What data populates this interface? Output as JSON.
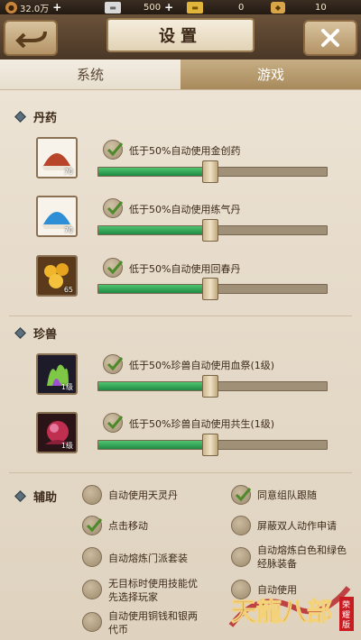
{
  "currency": {
    "copper": {
      "value": "32.0万"
    },
    "silver": {
      "value": "500"
    },
    "gold": {
      "value": "0"
    },
    "jade": {
      "value": "10"
    }
  },
  "header": {
    "title": "设置"
  },
  "tabs": [
    {
      "label": "系统",
      "active": false
    },
    {
      "label": "游戏",
      "active": true
    }
  ],
  "medicine": {
    "title": "丹药",
    "items": [
      {
        "label": "低于50%自动使用金创药",
        "count": "70",
        "checked": true,
        "level": 0.49
      },
      {
        "label": "低于50%自动使用练气丹",
        "count": "70",
        "checked": true,
        "level": 0.49
      },
      {
        "label": "低于50%自动使用回春丹",
        "count": "65",
        "checked": true,
        "level": 0.49
      }
    ]
  },
  "pets": {
    "title": "珍兽",
    "items": [
      {
        "label": "低于50%珍兽自动使用血祭(1级)",
        "badge": "1级",
        "checked": true,
        "level": 0.49
      },
      {
        "label": "低于50%珍兽自动使用共生(1级)",
        "badge": "1级",
        "checked": true,
        "level": 0.49
      }
    ]
  },
  "aux": {
    "title": "辅助",
    "options": [
      {
        "label": "自动使用天灵丹",
        "checked": false
      },
      {
        "label": "同意组队跟随",
        "checked": true
      },
      {
        "label": "点击移动",
        "checked": true
      },
      {
        "label": "屏蔽双人动作申请",
        "checked": false
      },
      {
        "label": "自动熔炼门派套装",
        "checked": false
      },
      {
        "label": "自动熔炼白色和绿色经脉装备",
        "checked": false
      },
      {
        "label": "无目标时使用技能优先选择玩家",
        "checked": false
      },
      {
        "label": "自动使用",
        "checked": false
      },
      {
        "label": "自动使用铜钱和银两代币",
        "checked": false
      }
    ]
  },
  "logo": {
    "text": "天龍八部",
    "sub": "荣耀版"
  },
  "colors": {
    "slider_fill": "#2fa653",
    "accent": "#a88a5c"
  }
}
